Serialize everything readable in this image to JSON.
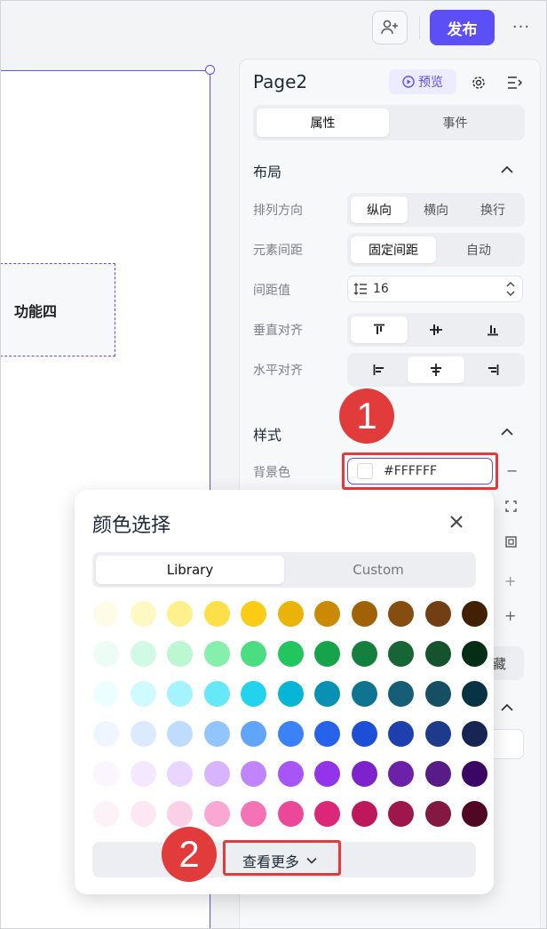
{
  "topbar": {
    "publish_label": "发布",
    "more_label": "···"
  },
  "canvas": {
    "feature_label": "功能四"
  },
  "panel": {
    "page_title": "Page2",
    "preview_label": "预览",
    "tabs": [
      "属性",
      "事件"
    ],
    "layout_section": "布局",
    "rows": {
      "direction_label": "排列方向",
      "direction_options": [
        "纵向",
        "横向",
        "换行"
      ],
      "spacing_label": "元素间距",
      "spacing_options": [
        "固定间距",
        "自动"
      ],
      "gap_label": "间距值",
      "gap_value": "16",
      "valign_label": "垂直对齐",
      "halign_label": "水平对齐"
    },
    "style_section": "样式",
    "bg_label": "背景色",
    "bg_value": "#FFFFFF",
    "partial_hide_text": "藏"
  },
  "annotations": {
    "badge1": "1",
    "badge2": "2",
    "accent": "#e23b3b"
  },
  "picker": {
    "title": "颜色选择",
    "tabs": [
      "Library",
      "Custom"
    ],
    "more_label": "查看更多",
    "rows": [
      [
        "#fefce8",
        "#fef9c3",
        "#fef08a",
        "#fde047",
        "#facc15",
        "#eab308",
        "#ca8a04",
        "#a16207",
        "#854d0e",
        "#713f12",
        "#422006"
      ],
      [
        "#ecfdf5",
        "#d1fae5",
        "#bbf7d0",
        "#86efac",
        "#4ade80",
        "#22c55e",
        "#16a34a",
        "#15803d",
        "#166534",
        "#14532d",
        "#052e16"
      ],
      [
        "#ecfeff",
        "#cffafe",
        "#a5f3fc",
        "#67e8f9",
        "#22d3ee",
        "#06b6d4",
        "#0891b2",
        "#0e7490",
        "#155e75",
        "#164e63",
        "#083344"
      ],
      [
        "#eff6ff",
        "#dbeafe",
        "#bfdbfe",
        "#93c5fd",
        "#60a5fa",
        "#3b82f6",
        "#2563eb",
        "#1d4ed8",
        "#1e40af",
        "#1e3a8a",
        "#172554"
      ],
      [
        "#faf5ff",
        "#f3e8ff",
        "#e9d5ff",
        "#d8b4fe",
        "#c084fc",
        "#a855f7",
        "#9333ea",
        "#7e22ce",
        "#6b21a8",
        "#581c87",
        "#3b0764"
      ],
      [
        "#fdf2f8",
        "#fce7f3",
        "#fbcfe8",
        "#f9a8d4",
        "#f472b6",
        "#ec4899",
        "#db2777",
        "#be185d",
        "#9d174d",
        "#831843",
        "#500724"
      ]
    ]
  }
}
